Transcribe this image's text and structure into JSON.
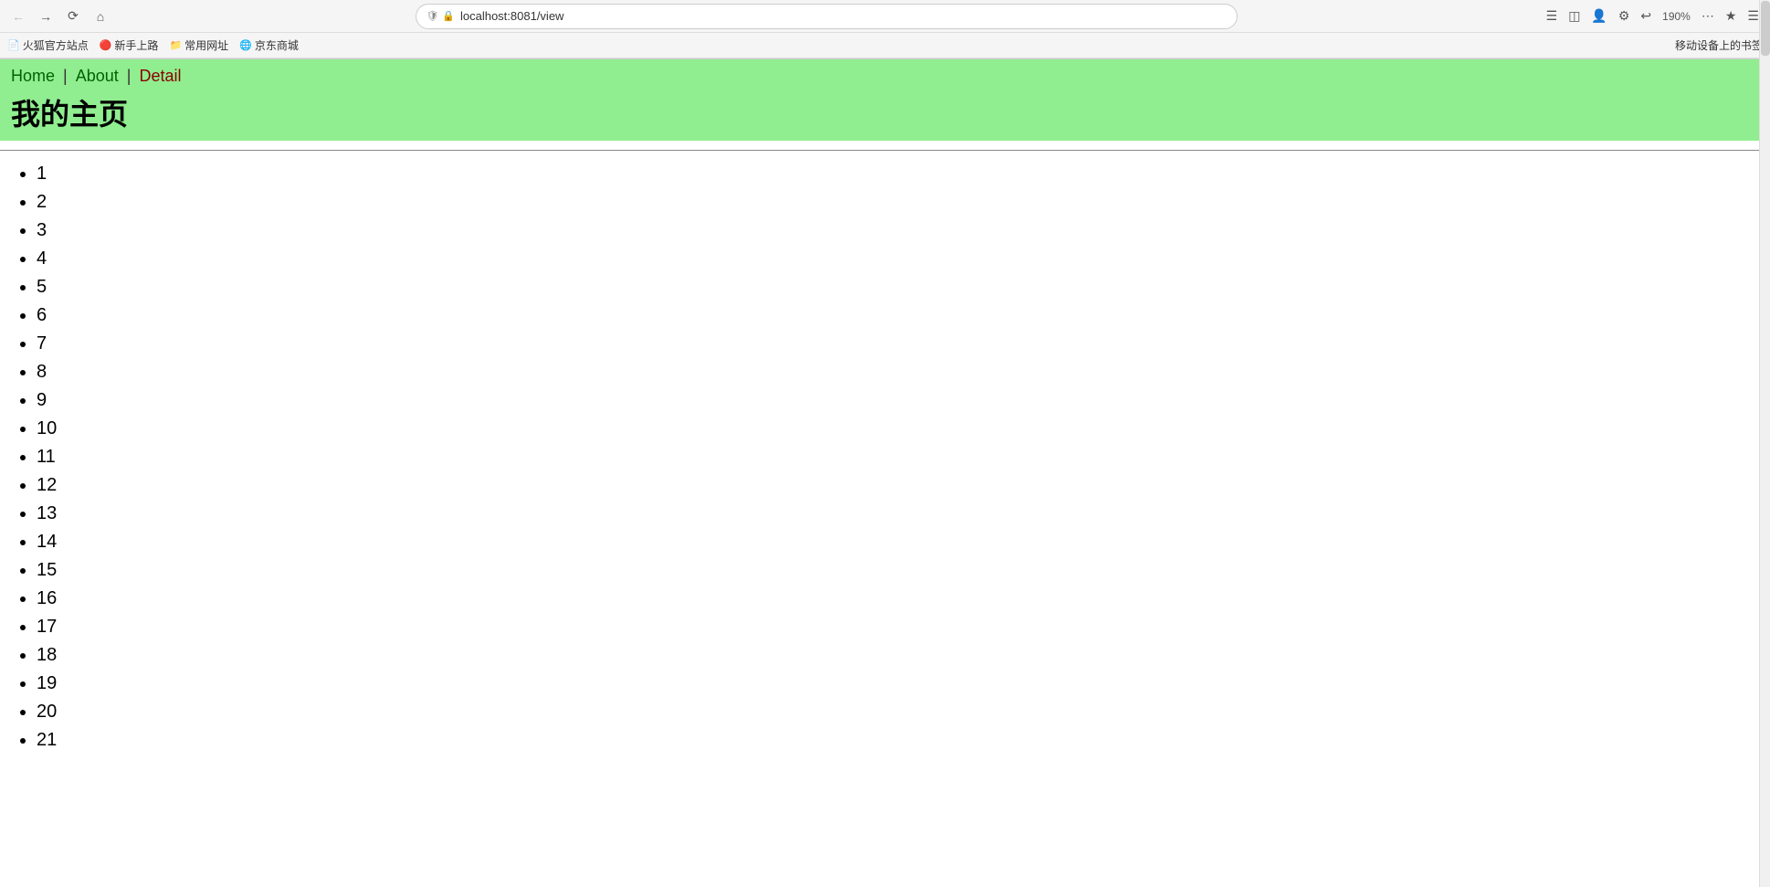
{
  "browser": {
    "url": "localhost:8081/view",
    "zoom": "190%",
    "bookmarks": [
      {
        "icon": "📄",
        "label": "火狐官方站点"
      },
      {
        "icon": "🔴",
        "label": "新手上路"
      },
      {
        "icon": "📁",
        "label": "常用网址"
      },
      {
        "icon": "🌐",
        "label": "京东商城"
      }
    ],
    "mobile_bookmarks_label": "移动设备上的书签"
  },
  "nav": {
    "home_label": "Home",
    "about_label": "About",
    "detail_label": "Detail",
    "separator": "|"
  },
  "page": {
    "title": "我的主页",
    "items": [
      "1",
      "2",
      "3",
      "4",
      "5",
      "6",
      "7",
      "8",
      "9",
      "10",
      "11",
      "12",
      "13",
      "14",
      "15",
      "16",
      "17",
      "18",
      "19",
      "20",
      "21"
    ]
  }
}
